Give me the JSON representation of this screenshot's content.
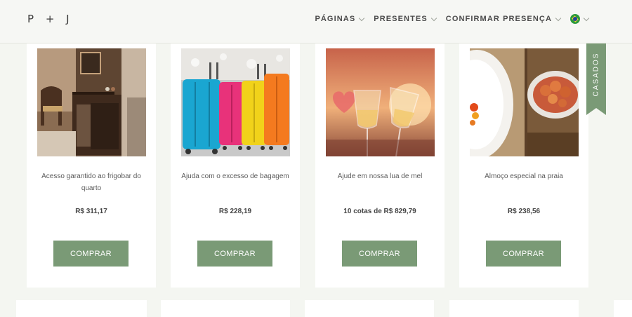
{
  "header": {
    "logo": "P + J",
    "nav": [
      {
        "label": "PÁGINAS"
      },
      {
        "label": "PRESENTES"
      },
      {
        "label": "CONFIRMAR PRESENÇA"
      }
    ],
    "language_icon": "brazil-flag-icon"
  },
  "ribbon": {
    "label": "CASADOS"
  },
  "gifts": [
    {
      "title": "Acesso garantido ao frigobar do quarto",
      "price": "R$ 311,17",
      "button": "COMPRAR",
      "image": "hotel-room-minibar"
    },
    {
      "title": "Ajuda com o excesso de bagagem",
      "price": "R$ 228,19",
      "button": "COMPRAR",
      "image": "colorful-suitcases"
    },
    {
      "title": "Ajude em nossa lua de mel",
      "price": "10 cotas de R$ 829,79",
      "button": "COMPRAR",
      "image": "wine-glasses-toast"
    },
    {
      "title": "Almoço especial na praia",
      "price": "R$ 238,56",
      "button": "COMPRAR",
      "image": "shrimp-lunch-plate"
    }
  ],
  "colors": {
    "accent": "#7a9a76",
    "background": "#f4f6f1",
    "card": "#ffffff",
    "header": "#f6f7f4"
  }
}
